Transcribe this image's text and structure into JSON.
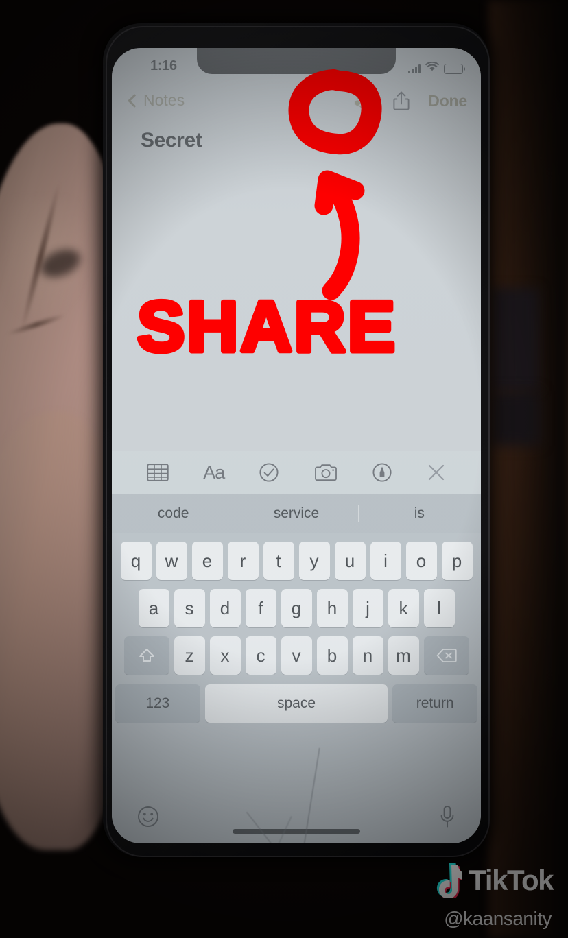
{
  "video": {
    "platform_watermark": "TikTok",
    "handle": "@kaansanity"
  },
  "annotation": {
    "label": "SHARE",
    "color": "#ff0000",
    "circle_target": "add-people-icon",
    "arrow": "curved-up-arrow"
  },
  "phone": {
    "status_bar": {
      "time": "1:16",
      "signal_icon": "cellular-signal-icon",
      "wifi_icon": "wifi-icon",
      "battery_icon": "battery-icon"
    },
    "nav_bar": {
      "back_label": "Notes",
      "back_icon": "chevron-left-icon",
      "add_people_icon": "add-people-icon",
      "share_icon": "share-icon",
      "done_label": "Done"
    },
    "note": {
      "title": "Secret",
      "body": ""
    },
    "format_toolbar": {
      "items": [
        {
          "icon": "table-icon",
          "label": "Table"
        },
        {
          "icon": "text-format-icon",
          "label": "Aa"
        },
        {
          "icon": "checklist-icon",
          "label": "Checklist"
        },
        {
          "icon": "camera-icon",
          "label": "Camera"
        },
        {
          "icon": "markup-pen-icon",
          "label": "Markup"
        },
        {
          "icon": "close-icon",
          "label": "Close"
        }
      ]
    },
    "keyboard": {
      "predictions": [
        "code",
        "service",
        "is"
      ],
      "rows": [
        [
          "q",
          "w",
          "e",
          "r",
          "t",
          "y",
          "u",
          "i",
          "o",
          "p"
        ],
        [
          "a",
          "s",
          "d",
          "f",
          "g",
          "h",
          "j",
          "k",
          "l"
        ],
        [
          "z",
          "x",
          "c",
          "v",
          "b",
          "n",
          "m"
        ]
      ],
      "shift_icon": "shift-up-arrow-icon",
      "delete_icon": "backspace-icon",
      "numbers_label": "123",
      "space_label": "space",
      "return_label": "return",
      "emoji_icon": "smiley-face-icon",
      "dictation_icon": "microphone-icon"
    }
  },
  "colors": {
    "annotation_red": "#ff0000",
    "screen_bg": "#ccd2d6",
    "keyboard_bg": "#b9c0c5",
    "key_face": "#f2f4f5",
    "key_modifier": "#a4adb4",
    "prediction_bar": "#b4bcc1",
    "nav_tint": "#9a9a8a"
  }
}
